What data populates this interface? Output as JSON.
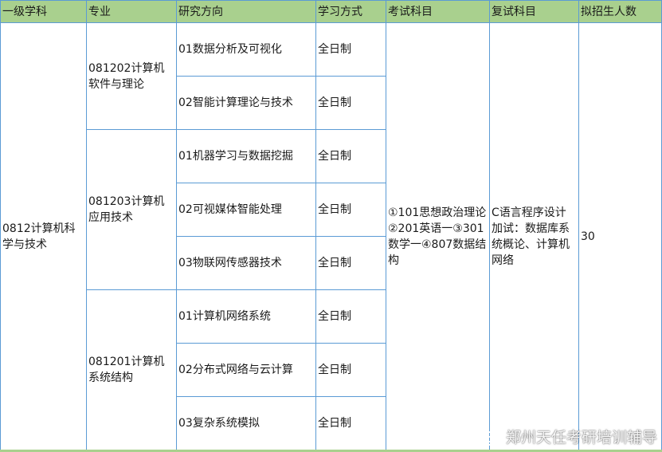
{
  "table": {
    "headers": [
      "一级学科",
      "专业",
      "研究方向",
      "学习方式",
      "考试科目",
      "复试科目",
      "拟招生人数"
    ],
    "discipline": "0812计算机科学与技术",
    "majors": [
      {
        "name": "081202计算机软件与理论"
      },
      {
        "name": "081203计算机应用技术"
      },
      {
        "name": "081201计算机系统结构"
      }
    ],
    "rows": [
      {
        "direction": "01数据分析及可视化",
        "mode": "全日制"
      },
      {
        "direction": "02智能计算理论与技术",
        "mode": "全日制"
      },
      {
        "direction": "01机器学习与数据挖掘",
        "mode": "全日制"
      },
      {
        "direction": "02可视媒体智能处理",
        "mode": "全日制"
      },
      {
        "direction": "03物联网传感器技术",
        "mode": "全日制"
      },
      {
        "direction": "01计算机网络系统",
        "mode": "全日制"
      },
      {
        "direction": "02分布式网络与云计算",
        "mode": "全日制"
      },
      {
        "direction": "03复杂系统模拟",
        "mode": "全日制"
      }
    ],
    "exam_subjects": "①101思想政治理论②201英语一③301数学一④807数据结构",
    "retest_subjects": "C语言程序设计加试：数据库系统概论、计算机网络",
    "enrollment": "30"
  },
  "watermark": {
    "text": "郑州天任考研培训辅导",
    "icon": "weibo-icon"
  },
  "colors": {
    "header_bg": "#a9d08e",
    "border": "#5b9bd5"
  }
}
